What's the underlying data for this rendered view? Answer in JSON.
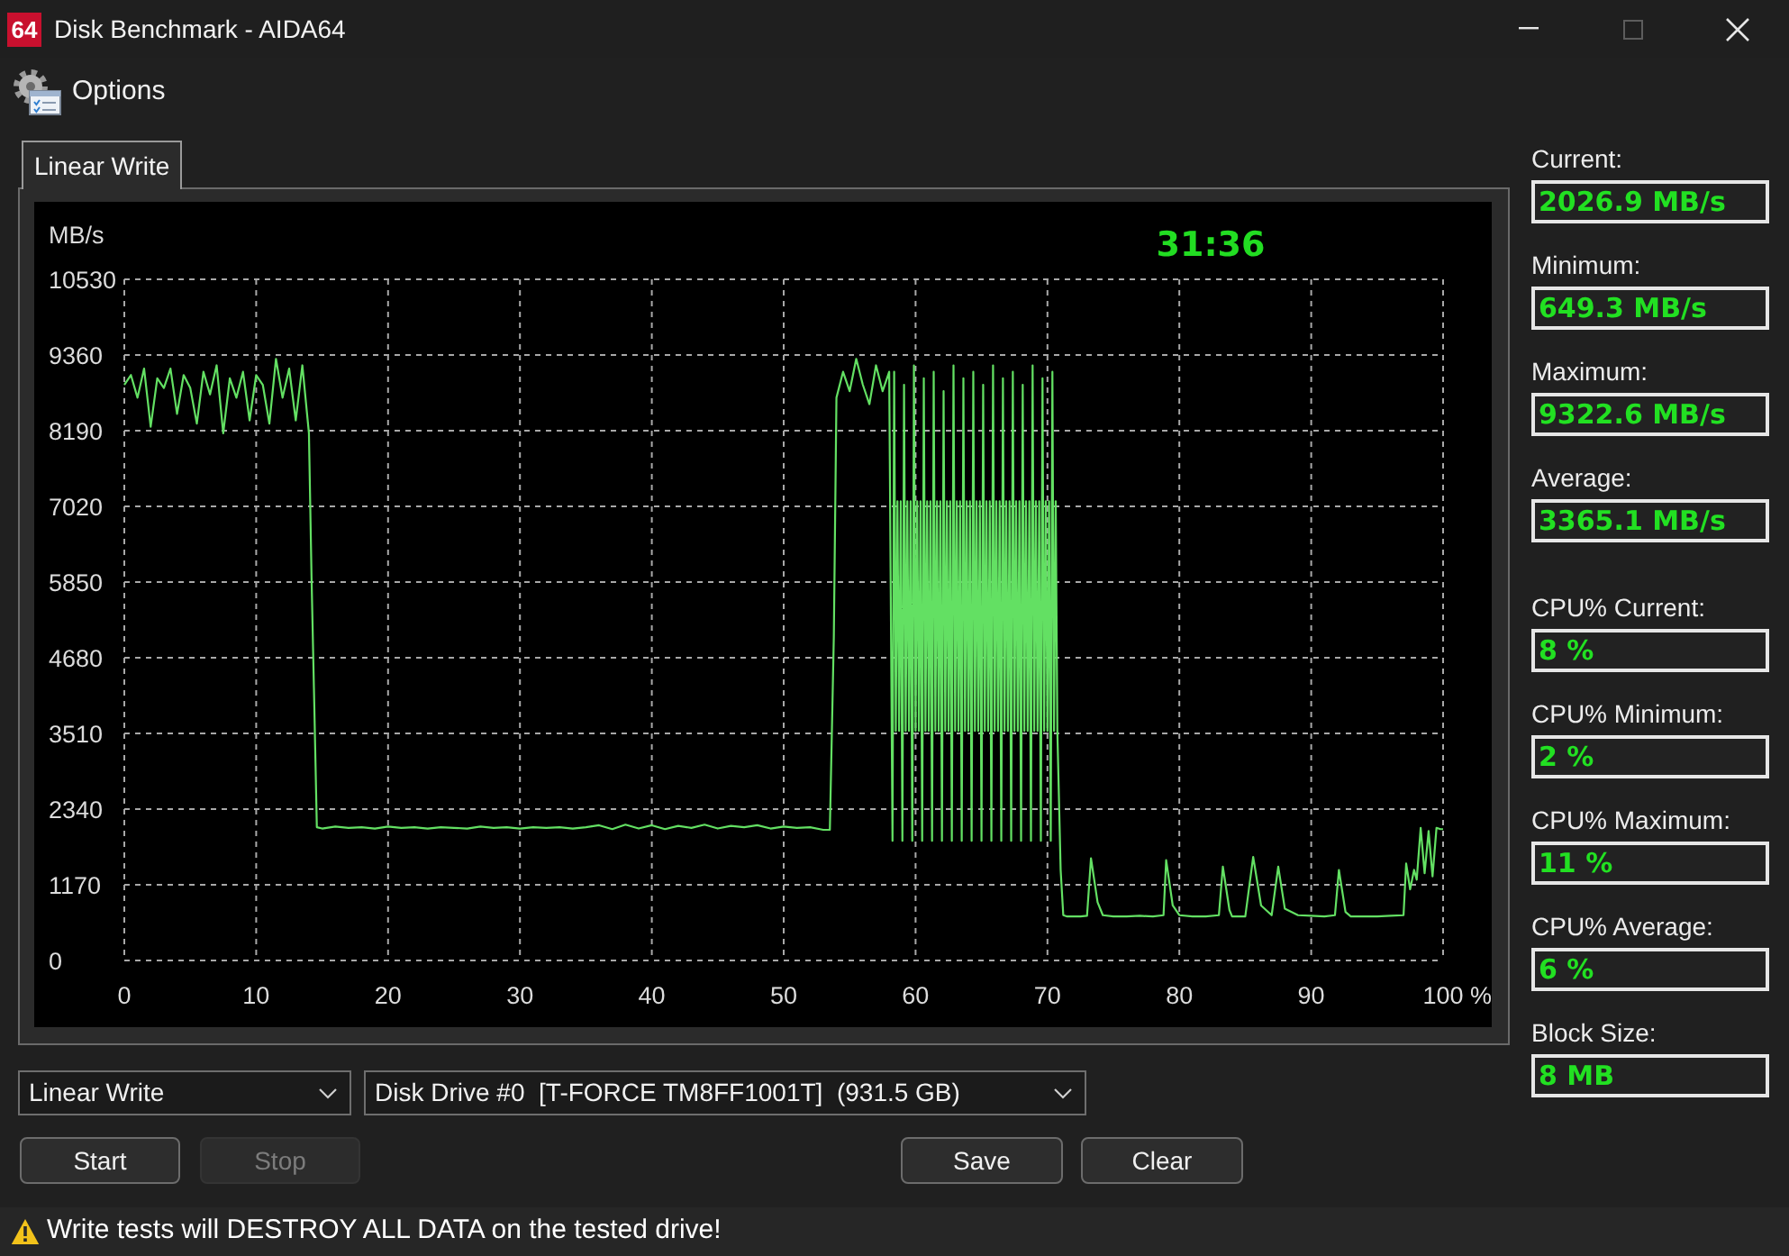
{
  "window": {
    "app_icon": "64",
    "title": "Disk Benchmark - AIDA64",
    "controls": [
      {
        "kind": "minimize",
        "disabled": false
      },
      {
        "kind": "maximize",
        "disabled": true
      },
      {
        "kind": "close",
        "disabled": false
      }
    ]
  },
  "menu": [
    {
      "label": "Options"
    }
  ],
  "tabs": [
    {
      "label": "Linear Write",
      "selected": true
    }
  ],
  "chart": {
    "timer": "31:36",
    "chart_data": {
      "type": "line",
      "xlabel": "%",
      "ylabel": "MB/s",
      "grid": true,
      "xlim": [
        0,
        100
      ],
      "ylim": [
        0,
        10530
      ],
      "xticks": [
        0,
        10,
        20,
        30,
        40,
        50,
        60,
        70,
        80,
        90,
        100
      ],
      "yticks": [
        0,
        1170,
        2340,
        3510,
        4680,
        5850,
        7020,
        8190,
        9360,
        10530
      ],
      "x": [
        0,
        0.5,
        1,
        1.5,
        2,
        2.5,
        3,
        3.5,
        4,
        4.5,
        5,
        5.5,
        6,
        6.5,
        7,
        7.5,
        8,
        8.5,
        9,
        9.5,
        10,
        10.5,
        11,
        11.5,
        12,
        12.5,
        13,
        13.5,
        14,
        14.2,
        14.4,
        14.6,
        15,
        16,
        17,
        18,
        19,
        20,
        21,
        22,
        23,
        24,
        25,
        26,
        27,
        28,
        29,
        30,
        31,
        32,
        33,
        34,
        35,
        36,
        37,
        38,
        39,
        40,
        41,
        42,
        43,
        44,
        45,
        46,
        47,
        48,
        49,
        50,
        51,
        52,
        53,
        53.5,
        53.8,
        54,
        54.5,
        55,
        55.5,
        56,
        56.5,
        57,
        57.5,
        58,
        58.25,
        58.375,
        58.5,
        58.625,
        58.75,
        58.875,
        59,
        59.125,
        59.25,
        59.375,
        59.5,
        59.625,
        59.75,
        59.875,
        60,
        60.125,
        60.25,
        60.375,
        60.5,
        60.625,
        60.75,
        60.875,
        61,
        61.125,
        61.25,
        61.375,
        61.5,
        61.625,
        61.75,
        61.875,
        62,
        62.125,
        62.25,
        62.375,
        62.5,
        62.625,
        62.75,
        62.875,
        63,
        63.125,
        63.25,
        63.375,
        63.5,
        63.625,
        63.75,
        63.875,
        64,
        64.125,
        64.25,
        64.375,
        64.5,
        64.625,
        64.75,
        64.875,
        65,
        65.125,
        65.25,
        65.375,
        65.5,
        65.625,
        65.75,
        65.875,
        66,
        66.125,
        66.25,
        66.375,
        66.5,
        66.625,
        66.75,
        66.875,
        67,
        67.125,
        67.25,
        67.375,
        67.5,
        67.625,
        67.75,
        67.875,
        68,
        68.125,
        68.25,
        68.375,
        68.5,
        68.625,
        68.75,
        68.875,
        69,
        69.125,
        69.25,
        69.375,
        69.5,
        69.625,
        69.75,
        69.875,
        70,
        70.125,
        70.25,
        70.375,
        70.5,
        70.625,
        70.75,
        71,
        71.2,
        71.5,
        72,
        72.5,
        73,
        73.3,
        73.8,
        74.2,
        75,
        76,
        77,
        78,
        78.8,
        79,
        79.5,
        80,
        81,
        82,
        83,
        83.3,
        83.8,
        84,
        85,
        85.6,
        86.2,
        87,
        87.5,
        88,
        89,
        90,
        91,
        91.8,
        92.1,
        92.6,
        93,
        94,
        95,
        96,
        97,
        97.2,
        97.5,
        97.8,
        98,
        98.3,
        98.6,
        98.9,
        99.2,
        99.5,
        99.8,
        100
      ],
      "values": [
        8900,
        9050,
        8700,
        9150,
        8250,
        9000,
        8850,
        9150,
        8450,
        9050,
        8850,
        8300,
        9100,
        8750,
        9200,
        8150,
        9000,
        8700,
        9100,
        8350,
        9050,
        8900,
        8300,
        9300,
        8700,
        9150,
        8350,
        9200,
        8150,
        5900,
        4000,
        2060,
        2040,
        2070,
        2050,
        2060,
        2040,
        2070,
        2050,
        2060,
        2040,
        2060,
        2050,
        2040,
        2070,
        2050,
        2060,
        2040,
        2060,
        2050,
        2060,
        2040,
        2060,
        2090,
        2030,
        2100,
        2040,
        2090,
        2030,
        2080,
        2050,
        2100,
        2040,
        2080,
        2060,
        2090,
        2040,
        2070,
        2050,
        2060,
        2020,
        2020,
        5000,
        8700,
        9100,
        8800,
        9300,
        8900,
        8600,
        9200,
        8800,
        9100,
        1850,
        9100,
        3550,
        7100,
        3550,
        7100,
        1850,
        8900,
        3550,
        7100,
        3550,
        7100,
        1850,
        9200,
        3550,
        7100,
        3550,
        7100,
        1850,
        9000,
        3550,
        7100,
        3550,
        7100,
        1850,
        9100,
        3550,
        7100,
        3550,
        7100,
        1850,
        8800,
        3550,
        7100,
        3550,
        7100,
        1850,
        9200,
        3550,
        7100,
        3550,
        7100,
        1850,
        9000,
        3550,
        7100,
        3550,
        7100,
        1850,
        9100,
        3550,
        7100,
        3550,
        7100,
        1850,
        8900,
        3550,
        7100,
        3550,
        7100,
        1850,
        9200,
        3550,
        7100,
        3550,
        7100,
        1850,
        9000,
        3550,
        7100,
        3550,
        7100,
        1850,
        9100,
        3550,
        7100,
        3550,
        7100,
        1850,
        8900,
        3550,
        7100,
        3550,
        7100,
        1850,
        9200,
        3550,
        7100,
        3550,
        7100,
        1850,
        9000,
        3550,
        7100,
        3550,
        7100,
        1850,
        9100,
        3550,
        7100,
        3550,
        1400,
        700,
        680,
        680,
        680,
        690,
        1580,
        900,
        700,
        680,
        680,
        690,
        680,
        700,
        1550,
        850,
        700,
        680,
        680,
        700,
        1450,
        780,
        680,
        680,
        1600,
        850,
        700,
        1450,
        800,
        700,
        690,
        680,
        700,
        1400,
        750,
        680,
        680,
        680,
        690,
        700,
        1500,
        1100,
        1400,
        1250,
        2050,
        1350,
        2000,
        1300,
        2050,
        2030,
        2030
      ]
    }
  },
  "controls": {
    "test_select": {
      "value": "Linear Write"
    },
    "drive_select": {
      "value": "Disk Drive #0  [T-FORCE TM8FF1001T]  (931.5 GB)"
    },
    "run_buttons": [
      {
        "label": "Start",
        "disabled": false
      },
      {
        "label": "Stop",
        "disabled": true
      }
    ],
    "file_buttons": [
      {
        "label": "Save",
        "disabled": false
      },
      {
        "label": "Clear",
        "disabled": false
      }
    ]
  },
  "stat_groups": [
    {
      "items": [
        {
          "label": "Current:",
          "value": "2026.9 MB/s"
        },
        {
          "label": "Minimum:",
          "value": "649.3 MB/s"
        },
        {
          "label": "Maximum:",
          "value": "9322.6 MB/s"
        },
        {
          "label": "Average:",
          "value": "3365.1 MB/s"
        }
      ]
    },
    {
      "items": [
        {
          "label": "CPU% Current:",
          "value": "8 %"
        },
        {
          "label": "CPU% Minimum:",
          "value": "2 %"
        },
        {
          "label": "CPU% Maximum:",
          "value": "11 %"
        },
        {
          "label": "CPU% Average:",
          "value": "6 %"
        },
        {
          "label": "Block Size:",
          "value": "8 MB"
        }
      ]
    }
  ],
  "status_bar": {
    "kind": "warning",
    "message": "Write tests will DESTROY ALL DATA on the tested drive!"
  }
}
